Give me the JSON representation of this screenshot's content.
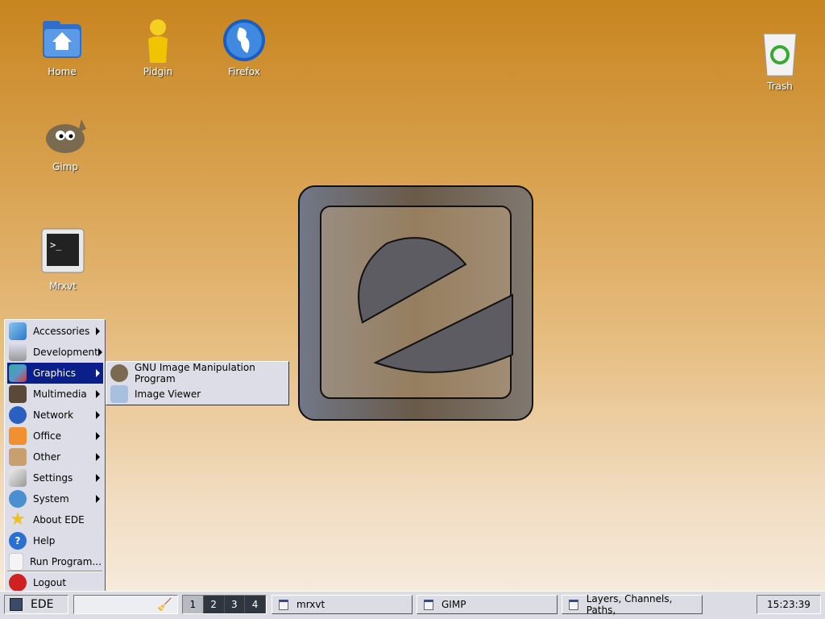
{
  "desktop": {
    "icons": [
      {
        "label": "Home",
        "icon": "home-folder-icon"
      },
      {
        "label": "Pidgin",
        "icon": "pidgin-icon"
      },
      {
        "label": "Firefox",
        "icon": "firefox-globe-icon"
      },
      {
        "label": "Gimp",
        "icon": "gimp-icon"
      },
      {
        "label": "Mrxvt",
        "icon": "terminal-icon"
      },
      {
        "label": "Trash",
        "icon": "trash-icon"
      }
    ]
  },
  "menu": {
    "items": [
      {
        "label": "Accessories",
        "submenu": true
      },
      {
        "label": "Development",
        "submenu": true
      },
      {
        "label": "Graphics",
        "submenu": true,
        "selected": true
      },
      {
        "label": "Multimedia",
        "submenu": true
      },
      {
        "label": "Network",
        "submenu": true
      },
      {
        "label": "Office",
        "submenu": true
      },
      {
        "label": "Other",
        "submenu": true
      },
      {
        "label": "Settings",
        "submenu": true
      },
      {
        "label": "System",
        "submenu": true
      },
      {
        "label": "About EDE"
      },
      {
        "label": "Help"
      },
      {
        "label": "Run Program..."
      },
      {
        "label": "Logout"
      }
    ],
    "graphics_submenu": [
      {
        "label": "GNU Image Manipulation Program"
      },
      {
        "label": "Image Viewer"
      }
    ]
  },
  "taskbar": {
    "start_label": "EDE",
    "workspaces": [
      "1",
      "2",
      "3",
      "4"
    ],
    "active_workspace": "1",
    "tasks": [
      {
        "label": "mrxvt"
      },
      {
        "label": "GIMP"
      },
      {
        "label": "Layers, Channels, Paths,"
      }
    ],
    "clock": "15:23:39"
  },
  "colors": {
    "menu_highlight": "#0a1f8a",
    "taskbar": "#dcdde4"
  }
}
